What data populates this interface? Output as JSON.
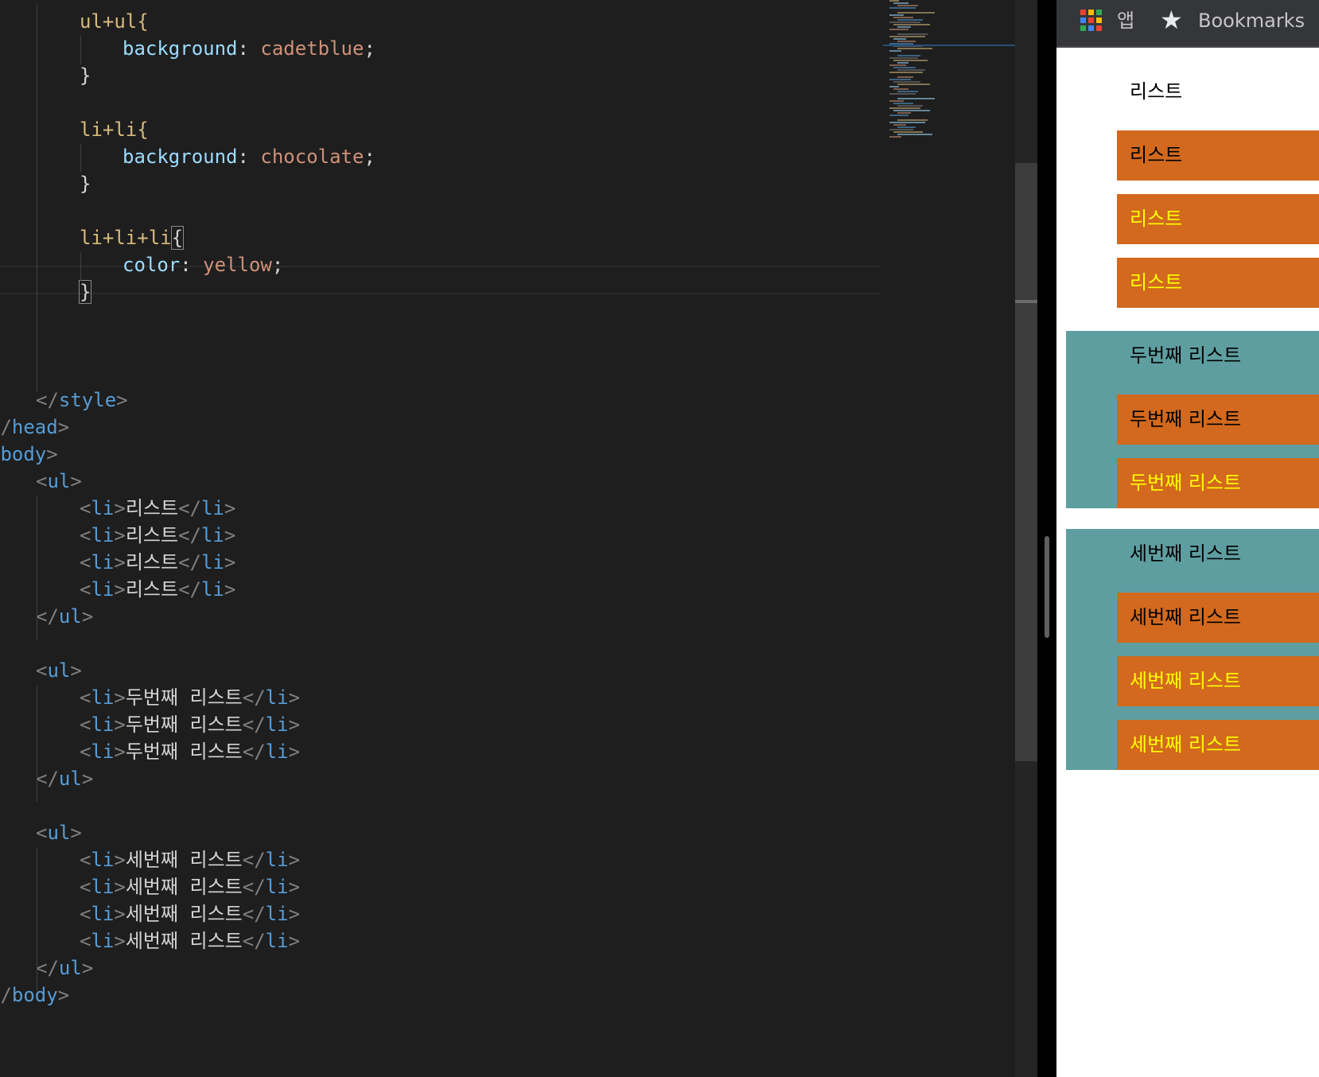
{
  "editor": {
    "lines": [
      [
        {
          "t": "ul+ul{",
          "c": "sel"
        }
      ],
      [
        {
          "t": "background",
          "c": "prop"
        },
        {
          "t": ": ",
          "c": "punct"
        },
        {
          "t": "cadetblue",
          "c": "val"
        },
        {
          "t": ";",
          "c": "punct"
        }
      ],
      [
        {
          "t": "}",
          "c": "punct"
        }
      ],
      [],
      [
        {
          "t": "li+li{",
          "c": "sel"
        }
      ],
      [
        {
          "t": "background",
          "c": "prop"
        },
        {
          "t": ": ",
          "c": "punct"
        },
        {
          "t": "chocolate",
          "c": "val"
        },
        {
          "t": ";",
          "c": "punct"
        }
      ],
      [
        {
          "t": "}",
          "c": "punct"
        }
      ],
      [],
      [
        {
          "t": "li+li+li",
          "c": "sel"
        },
        {
          "t": "{",
          "c": "punct",
          "box": true
        }
      ],
      [
        {
          "t": "color",
          "c": "prop"
        },
        {
          "t": ": ",
          "c": "punct"
        },
        {
          "t": "yellow",
          "c": "val"
        },
        {
          "t": ";",
          "c": "punct"
        }
      ],
      [
        {
          "t": "}",
          "c": "punct",
          "box": true
        }
      ],
      [],
      [],
      [],
      [
        {
          "t": "</",
          "c": "bracket"
        },
        {
          "t": "style",
          "c": "tag"
        },
        {
          "t": ">",
          "c": "bracket"
        }
      ],
      [
        {
          "t": "</",
          "c": "bracket"
        },
        {
          "t": "head",
          "c": "tag"
        },
        {
          "t": ">",
          "c": "bracket"
        }
      ],
      [
        {
          "t": "<",
          "c": "bracket"
        },
        {
          "t": "body",
          "c": "tag"
        },
        {
          "t": ">",
          "c": "bracket"
        }
      ],
      [
        {
          "t": "<",
          "c": "bracket"
        },
        {
          "t": "ul",
          "c": "tag"
        },
        {
          "t": ">",
          "c": "bracket"
        }
      ],
      [
        {
          "t": "<",
          "c": "bracket"
        },
        {
          "t": "li",
          "c": "tag"
        },
        {
          "t": ">",
          "c": "bracket"
        },
        {
          "t": "리스트",
          "c": "text"
        },
        {
          "t": "</",
          "c": "bracket"
        },
        {
          "t": "li",
          "c": "tag"
        },
        {
          "t": ">",
          "c": "bracket"
        }
      ],
      [
        {
          "t": "<",
          "c": "bracket"
        },
        {
          "t": "li",
          "c": "tag"
        },
        {
          "t": ">",
          "c": "bracket"
        },
        {
          "t": "리스트",
          "c": "text"
        },
        {
          "t": "</",
          "c": "bracket"
        },
        {
          "t": "li",
          "c": "tag"
        },
        {
          "t": ">",
          "c": "bracket"
        }
      ],
      [
        {
          "t": "<",
          "c": "bracket"
        },
        {
          "t": "li",
          "c": "tag"
        },
        {
          "t": ">",
          "c": "bracket"
        },
        {
          "t": "리스트",
          "c": "text"
        },
        {
          "t": "</",
          "c": "bracket"
        },
        {
          "t": "li",
          "c": "tag"
        },
        {
          "t": ">",
          "c": "bracket"
        }
      ],
      [
        {
          "t": "<",
          "c": "bracket"
        },
        {
          "t": "li",
          "c": "tag"
        },
        {
          "t": ">",
          "c": "bracket"
        },
        {
          "t": "리스트",
          "c": "text"
        },
        {
          "t": "</",
          "c": "bracket"
        },
        {
          "t": "li",
          "c": "tag"
        },
        {
          "t": ">",
          "c": "bracket"
        }
      ],
      [
        {
          "t": "</",
          "c": "bracket"
        },
        {
          "t": "ul",
          "c": "tag"
        },
        {
          "t": ">",
          "c": "bracket"
        }
      ],
      [],
      [
        {
          "t": "<",
          "c": "bracket"
        },
        {
          "t": "ul",
          "c": "tag"
        },
        {
          "t": ">",
          "c": "bracket"
        }
      ],
      [
        {
          "t": "<",
          "c": "bracket"
        },
        {
          "t": "li",
          "c": "tag"
        },
        {
          "t": ">",
          "c": "bracket"
        },
        {
          "t": "두번째 리스트",
          "c": "text"
        },
        {
          "t": "</",
          "c": "bracket"
        },
        {
          "t": "li",
          "c": "tag"
        },
        {
          "t": ">",
          "c": "bracket"
        }
      ],
      [
        {
          "t": "<",
          "c": "bracket"
        },
        {
          "t": "li",
          "c": "tag"
        },
        {
          "t": ">",
          "c": "bracket"
        },
        {
          "t": "두번째 리스트",
          "c": "text"
        },
        {
          "t": "</",
          "c": "bracket"
        },
        {
          "t": "li",
          "c": "tag"
        },
        {
          "t": ">",
          "c": "bracket"
        }
      ],
      [
        {
          "t": "<",
          "c": "bracket"
        },
        {
          "t": "li",
          "c": "tag"
        },
        {
          "t": ">",
          "c": "bracket"
        },
        {
          "t": "두번째 리스트",
          "c": "text"
        },
        {
          "t": "</",
          "c": "bracket"
        },
        {
          "t": "li",
          "c": "tag"
        },
        {
          "t": ">",
          "c": "bracket"
        }
      ],
      [
        {
          "t": "</",
          "c": "bracket"
        },
        {
          "t": "ul",
          "c": "tag"
        },
        {
          "t": ">",
          "c": "bracket"
        }
      ],
      [],
      [
        {
          "t": "<",
          "c": "bracket"
        },
        {
          "t": "ul",
          "c": "tag"
        },
        {
          "t": ">",
          "c": "bracket"
        }
      ],
      [
        {
          "t": "<",
          "c": "bracket"
        },
        {
          "t": "li",
          "c": "tag"
        },
        {
          "t": ">",
          "c": "bracket"
        },
        {
          "t": "세번째 리스트",
          "c": "text"
        },
        {
          "t": "</",
          "c": "bracket"
        },
        {
          "t": "li",
          "c": "tag"
        },
        {
          "t": ">",
          "c": "bracket"
        }
      ],
      [
        {
          "t": "<",
          "c": "bracket"
        },
        {
          "t": "li",
          "c": "tag"
        },
        {
          "t": ">",
          "c": "bracket"
        },
        {
          "t": "세번째 리스트",
          "c": "text"
        },
        {
          "t": "</",
          "c": "bracket"
        },
        {
          "t": "li",
          "c": "tag"
        },
        {
          "t": ">",
          "c": "bracket"
        }
      ],
      [
        {
          "t": "<",
          "c": "bracket"
        },
        {
          "t": "li",
          "c": "tag"
        },
        {
          "t": ">",
          "c": "bracket"
        },
        {
          "t": "세번째 리스트",
          "c": "text"
        },
        {
          "t": "</",
          "c": "bracket"
        },
        {
          "t": "li",
          "c": "tag"
        },
        {
          "t": ">",
          "c": "bracket"
        }
      ],
      [
        {
          "t": "<",
          "c": "bracket"
        },
        {
          "t": "li",
          "c": "tag"
        },
        {
          "t": ">",
          "c": "bracket"
        },
        {
          "t": "세번째 리스트",
          "c": "text"
        },
        {
          "t": "</",
          "c": "bracket"
        },
        {
          "t": "li",
          "c": "tag"
        },
        {
          "t": ">",
          "c": "bracket"
        }
      ],
      [
        {
          "t": "</",
          "c": "bracket"
        },
        {
          "t": "ul",
          "c": "tag"
        },
        {
          "t": ">",
          "c": "bracket"
        }
      ],
      [
        {
          "t": "</",
          "c": "bracket"
        },
        {
          "t": "body",
          "c": "tag"
        },
        {
          "t": ">",
          "c": "bracket"
        }
      ]
    ]
  },
  "bookmarks_bar": {
    "apps_label": "앱",
    "bookmarks_label": "Bookmarks",
    "apps_icon": "apps-grid-icon",
    "star_icon": "star-icon"
  },
  "preview": {
    "colors": {
      "ul_bg": "cadetblue",
      "li_bg": "chocolate",
      "third_text": "yellow"
    },
    "lists": [
      {
        "items": [
          "리스트",
          "리스트",
          "리스트",
          "리스트"
        ]
      },
      {
        "items": [
          "두번째 리스트",
          "두번째 리스트",
          "두번째 리스트"
        ]
      },
      {
        "items": [
          "세번째 리스트",
          "세번째 리스트",
          "세번째 리스트",
          "세번째 리스트"
        ]
      }
    ]
  }
}
